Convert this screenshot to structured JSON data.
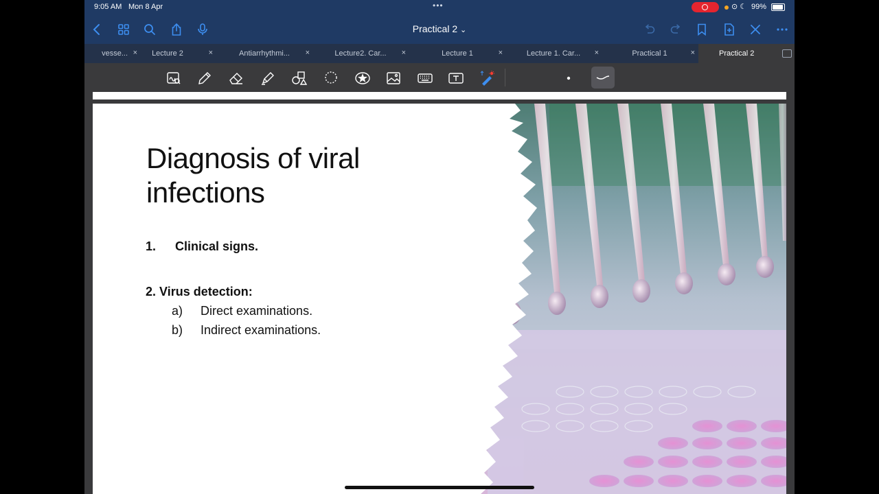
{
  "status": {
    "time": "9:05 AM",
    "date": "Mon 8 Apr",
    "battery": "99%"
  },
  "nav": {
    "title": "Practical 2",
    "title_chevron": "⌄"
  },
  "tabs": [
    {
      "label": "vesse...",
      "active": false
    },
    {
      "label": "Lecture 2",
      "active": false
    },
    {
      "label": "Antiarrhythmi...",
      "active": false
    },
    {
      "label": "Lecture2. Car...",
      "active": false
    },
    {
      "label": "Lecture 1",
      "active": false
    },
    {
      "label": "Lecture 1. Car...",
      "active": false
    },
    {
      "label": "Practical 1",
      "active": false
    },
    {
      "label": "Practical 2",
      "active": true
    }
  ],
  "tab_close": "×",
  "toolbar_icons": [
    "zoom-window-icon",
    "pen-icon",
    "eraser-icon",
    "highlighter-icon",
    "shapes-icon",
    "lasso-icon",
    "sticker-icon",
    "image-icon",
    "keyboard-icon",
    "text-icon",
    "laser-pointer-icon"
  ],
  "slide": {
    "title_line1": "Diagnosis of viral",
    "title_line2": "infections",
    "item1_num": "1.",
    "item1_text": "Clinical signs.",
    "item2_heading": "2. Virus detection:",
    "sub_a_letter": "a)",
    "sub_a_text": "Direct examinations.",
    "sub_b_letter": "b)",
    "sub_b_text": "Indirect examinations."
  },
  "colors": {
    "nav_bg": "#1f3a64",
    "tab_bg": "#24324a",
    "accent": "#3d8ef0",
    "record": "#e4252f",
    "toolbar_bg": "#3a3a3c"
  }
}
